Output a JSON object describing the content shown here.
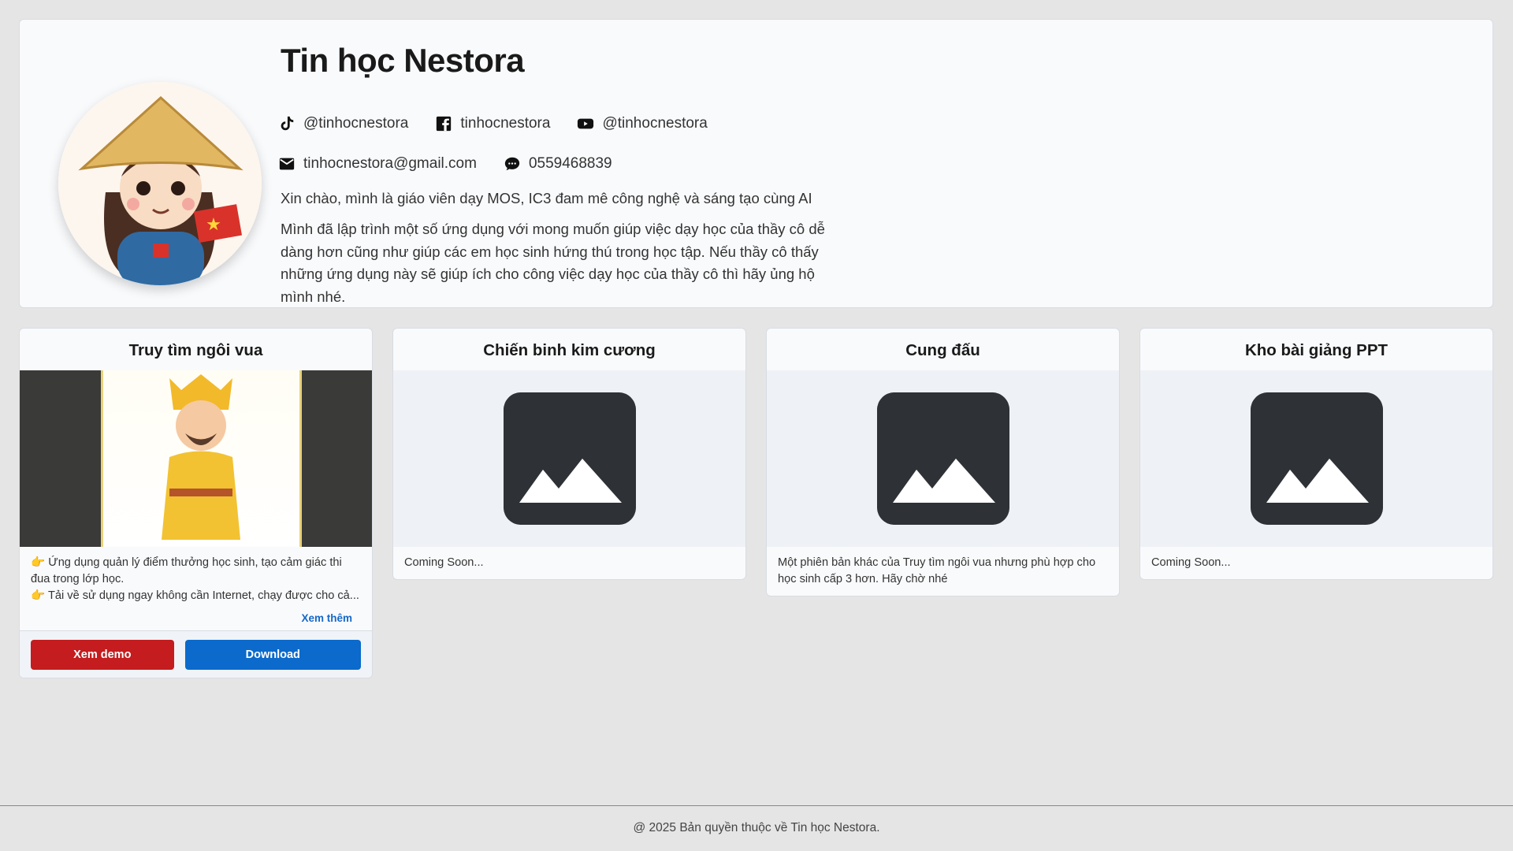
{
  "profile": {
    "name": "Tin học Nestora",
    "tiktok": "@tinhocnestora",
    "facebook": "tinhocnestora",
    "youtube": "@tinhocnestora",
    "email": "tinhocnestora@gmail.com",
    "phone": "0559468839",
    "intro": "Xin chào, mình là giáo viên dạy MOS, IC3 đam mê công nghệ và sáng tạo cùng AI",
    "paragraph": "Mình đã lập trình một số ứng dụng với mong muốn giúp việc dạy học của thầy cô dễ dàng hơn cũng như giúp các em học sinh hứng thú trong học tập. Nếu thầy cô thấy những ứng dụng này sẽ giúp ích cho công việc dạy học của thầy cô thì hãy ủng hộ mình nhé."
  },
  "cards": [
    {
      "title": "Truy tìm ngôi vua",
      "desc1": "👉 Ứng dụng quản lý điểm thưởng học sinh, tạo cảm giác thi đua trong lớp học.",
      "desc2": "👉 Tải về sử dụng ngay không cần Internet, chạy được cho cả...",
      "more": "Xem thêm",
      "demo": "Xem demo",
      "download": "Download"
    },
    {
      "title": "Chiến binh kim cương",
      "desc": "Coming Soon..."
    },
    {
      "title": "Cung đấu",
      "desc": "Một phiên bản khác của Truy tìm ngôi vua nhưng phù hợp cho học sinh cấp 3 hơn. Hãy chờ nhé"
    },
    {
      "title": "Kho bài giảng PPT",
      "desc": "Coming Soon..."
    }
  ],
  "colors": {
    "demo": "#c41c1f",
    "download": "#0b6acb",
    "link": "#1468c8"
  },
  "footer": "@ 2025 Bản quyền thuộc về Tin học Nestora."
}
